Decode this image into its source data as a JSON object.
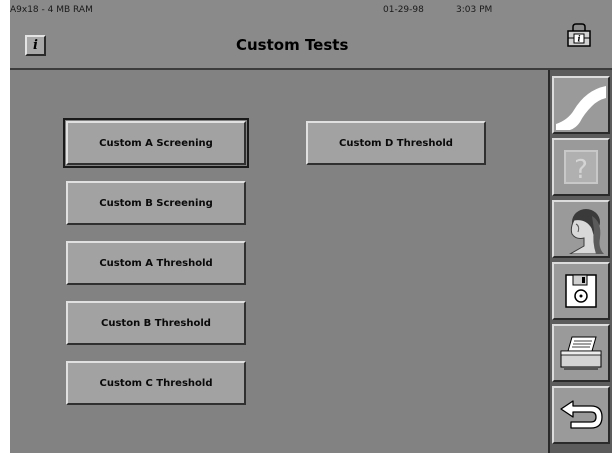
{
  "header": {
    "ram_label": "A9x18 - 4 MB RAM",
    "date": "01-29-98",
    "time": "3:03 PM",
    "title": "Custom Tests",
    "info_button_label": "i"
  },
  "tests": {
    "custom_a_screening": "Custom A Screening",
    "custom_b_screening": "Custom B Screening",
    "custom_a_threshold": "Custom A Threshold",
    "custon_b_threshold": "Custon B Threshold",
    "custom_c_threshold": "Custom C Threshold",
    "custom_d_threshold": "Custom D Threshold"
  },
  "sidebar_icons": [
    "graph-icon",
    "help-icon",
    "patient-icon",
    "save-disk-icon",
    "printer-icon",
    "back-arrow-icon"
  ],
  "colors": {
    "screen_bg": "#828282",
    "button_face": "#a2a2a2",
    "sidebar_bg": "#5c5c5c"
  }
}
